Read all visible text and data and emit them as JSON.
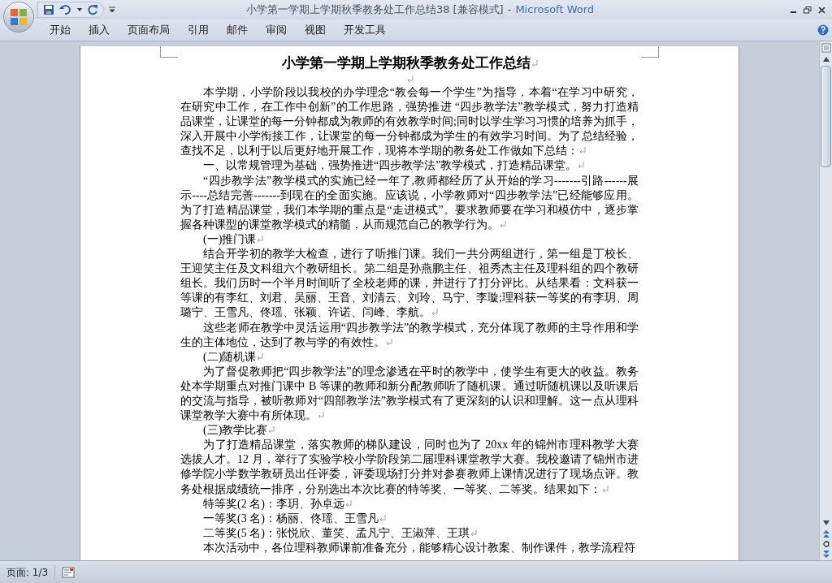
{
  "window": {
    "title": "小学第一学期上学期秋季教务处工作总结38 [兼容模式]",
    "separator": "-",
    "app_name": "Microsoft Word"
  },
  "tabs": [
    {
      "label": "开始",
      "selected": false
    },
    {
      "label": "插入",
      "selected": false
    },
    {
      "label": "页面布局",
      "selected": false
    },
    {
      "label": "引用",
      "selected": false
    },
    {
      "label": "邮件",
      "selected": false
    },
    {
      "label": "审阅",
      "selected": false
    },
    {
      "label": "视图",
      "selected": false
    },
    {
      "label": "开发工具",
      "selected": false
    }
  ],
  "document": {
    "paragraphs": [
      {
        "kind": "title",
        "text": "小学第一学期上学期秋季教务处工作总结",
        "end_mark": true
      },
      {
        "kind": "empty",
        "end_mark": true
      },
      {
        "kind": "body",
        "text": "本学期，小学阶段以我校的办学理念“教会每一个学生”为指导，本着“在学习中研究，在研究中工作，在工作中创新”的工作思路，强势推进 “四步教学法”教学模式，努力打造精品课堂，让课堂的每一分钟都成为教师的有效教学时间;同时以学生学习习惯的培养为抓手，深入开展中小学衔接工作，让课堂的每一分钟都成为学生的有效学习时间。为了总结经验，查找不足，以利于以后更好地开展工作，现将本学期的教务处工作做如下总结：",
        "end_mark": true
      },
      {
        "kind": "body",
        "text": "一、以常规管理为基础，强势推进“四步教学法”教学模式，打造精品课堂。",
        "end_mark": true
      },
      {
        "kind": "body",
        "text": "“四步教学法”教学模式的实施已经一年了,教师都经历了从开始的学习-------引路------展示----总结完善-------到现在的全面实施。应该说，小学教师对“四步教学法”已经能够应用。为了打造精品课堂，我们本学期的重点是“走进模式”。要求教师要在学习和模仿中，逐步掌握各种课型的课堂教学模式的精髓，从而规范自己的教学行为。",
        "end_mark": true
      },
      {
        "kind": "body",
        "text": "(一)推门课",
        "end_mark": true
      },
      {
        "kind": "body",
        "text": "结合开学初的教学大检查，进行了听推门课。我们一共分两组进行，第一组是丁校长、王迎笑主任及文科组六个教研组长。第二组是孙燕鹏主任、祖秀杰主任及理科组的四个教研组长。我们历时一个半月时间听了全校老师的课，并进行了打分评比。从结果看：文科获一等课的有李红、刘君、吴丽、王音、刘清云、刘玲、马宁、李璇;理科获一等奖的有李玥、周璐宁、王雪凡、佟瑶、张颖、许诺、闫峰、李航。",
        "end_mark": true
      },
      {
        "kind": "body",
        "text": "这些老师在教学中灵活运用“四步教学法”的教学模式，充分体现了教师的主导作用和学生的主体地位，达到了教与学的有效性。",
        "end_mark": true
      },
      {
        "kind": "body",
        "text": "(二)随机课",
        "end_mark": true
      },
      {
        "kind": "body",
        "text": "为了督促教师把“四步教学法”的理念渗透在平时的教学中，使学生有更大的收益。教务处本学期重点对推门课中 B 等课的教师和新分配教师听了随机课。通过听随机课以及听课后的交流与指导，被听教师对“四部教学法”教学模式有了更深刻的认识和理解。这一点从理科课堂教学大赛中有所体现。",
        "end_mark": true
      },
      {
        "kind": "body",
        "text": "(三)教学比赛",
        "end_mark": true
      },
      {
        "kind": "body",
        "text": "为了打造精品课堂，落实教师的梯队建设，同时也为了 20xx 年的锦州市理科教学大赛选拔人才。12 月，举行了实验学校小学阶段第二届理科课堂教学大赛。我校邀请了锦州市进修学院小学数学教研员出任评委，评委现场打分并对参赛教师上课情况进行了现场点评。教务处根据成绩统一排序，分别选出本次比赛的特等奖、一等奖、二等奖。结果如下：",
        "end_mark": true
      },
      {
        "kind": "body",
        "text": "特等奖(2 名)：李玥、孙卓远",
        "end_mark": true
      },
      {
        "kind": "body",
        "text": "一等奖(3 名)：杨丽、佟瑶、王雪凡",
        "end_mark": true
      },
      {
        "kind": "body",
        "text": "二等奖(5 名)：张悦欣、董笑、孟凡宁、王淑萍、王琪",
        "end_mark": true
      },
      {
        "kind": "body",
        "text": "本次活动中，各位理科教师课前准备充分，能够精心设计教案、制作课件，教学流程符",
        "end_mark": false
      }
    ]
  },
  "status_bar": {
    "page": "页面: 1/3"
  }
}
